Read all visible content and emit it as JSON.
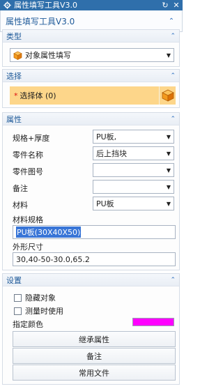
{
  "window": {
    "title": "属性填写工具V3.0"
  },
  "dialog": {
    "title": "属性填写工具V3.0"
  },
  "type_group": {
    "label": "类型",
    "selected": "对象属性填写",
    "icon": "cube-icon"
  },
  "select_group": {
    "label": "选择",
    "required_mark": "*",
    "select_label": "选择体 (0)",
    "icon": "cube-icon"
  },
  "attr_group": {
    "label": "属性",
    "spec_thickness": {
      "label": "规格+厚度",
      "value": "PU板,"
    },
    "part_name": {
      "label": "零件名称",
      "value": "后上挡块"
    },
    "part_number": {
      "label": "零件图号",
      "value": ""
    },
    "remark": {
      "label": "备注",
      "value": ""
    },
    "material": {
      "label": "材料",
      "value": "PU板"
    },
    "material_spec": {
      "label": "材料规格",
      "value": "PU板(30X40X50)"
    },
    "dimensions": {
      "label": "外形尺寸",
      "value": "30,40-50-30.0,65.2"
    }
  },
  "settings_group": {
    "label": "设置",
    "hide_object": "隐藏对象",
    "use_when_measuring": "测量时使用",
    "specify_color": "指定颜色",
    "color_swatch": "#ff00ff"
  },
  "buttons": {
    "inherit": "继承属性",
    "remark": "备注",
    "common_files": "常用文件"
  },
  "colors": {
    "titlebar": "#2f6fab",
    "accent_text": "#1f5a99",
    "selection_bar": "#fdd68a",
    "cube_orange": "#f39a1e"
  }
}
